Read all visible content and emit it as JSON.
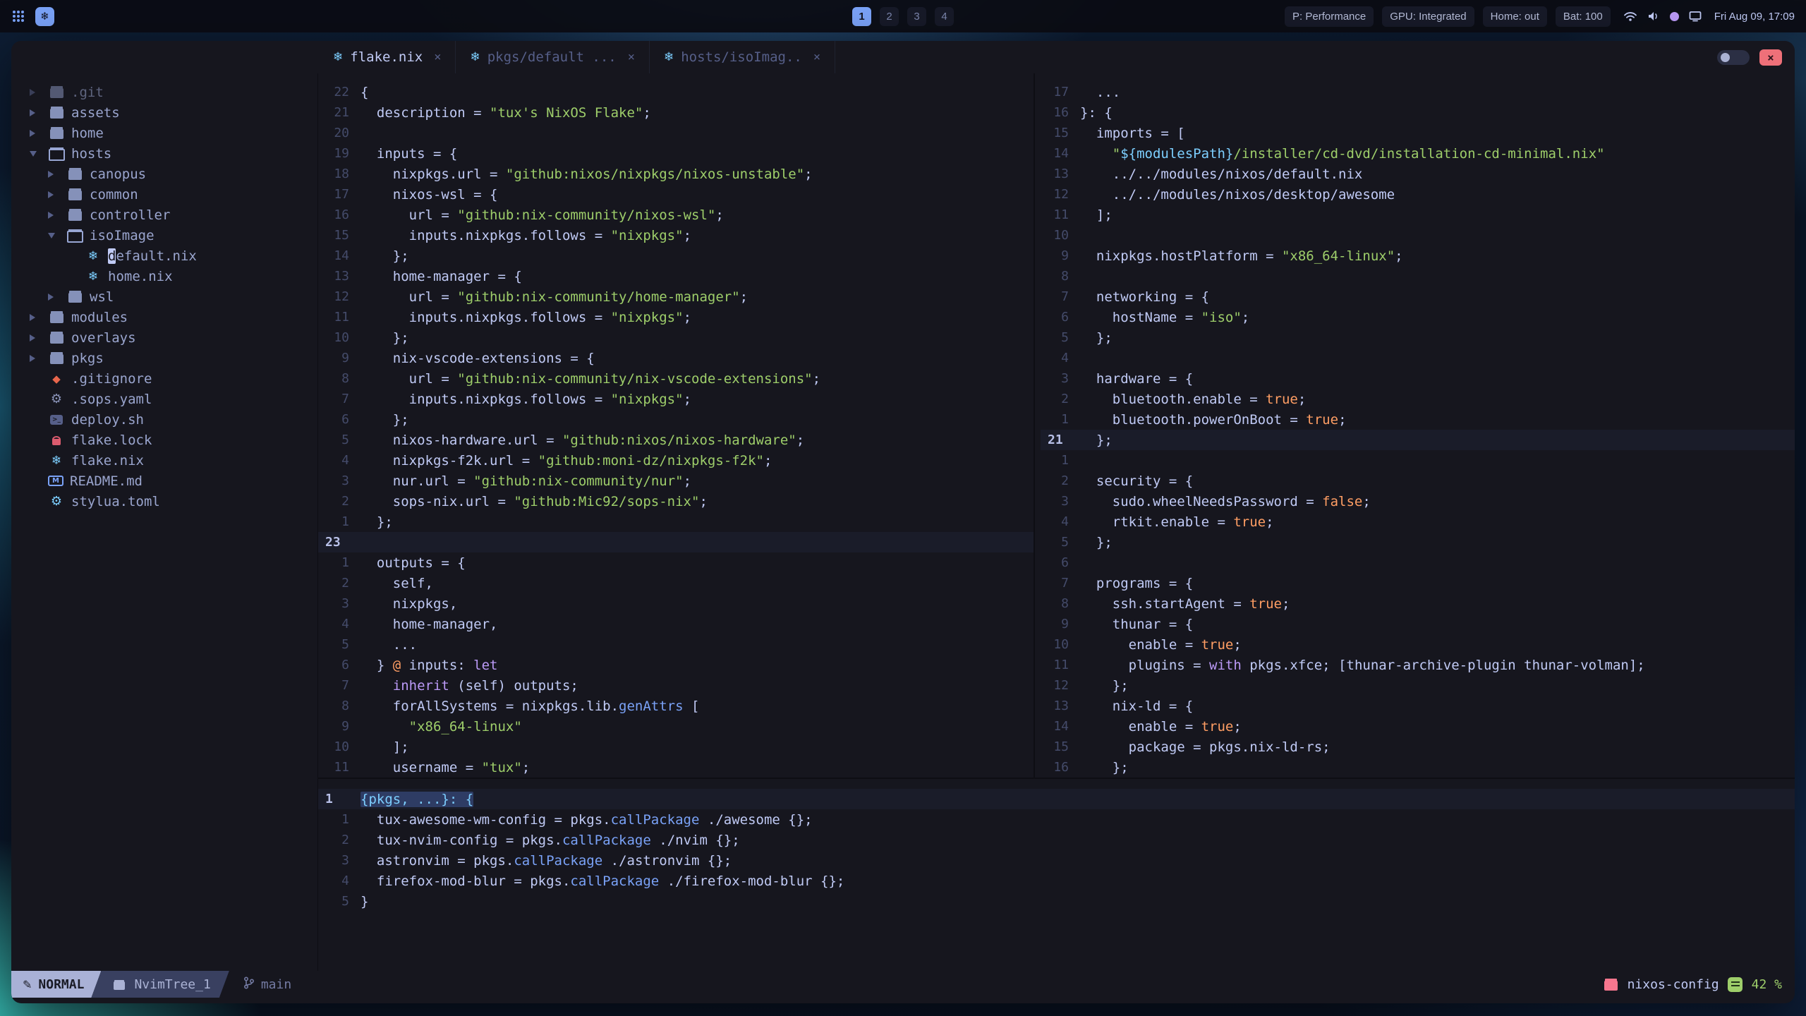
{
  "colors": {
    "accent": "#7aa2f7",
    "bg": "#16161e",
    "string": "#9ece6a",
    "boolean": "#ff9e64",
    "keyword": "#bb9af7",
    "function_": "#7aa2f7",
    "pink": "#f7768e",
    "green": "#9ece6a",
    "cyan": "#7dcfff"
  },
  "icons": {
    "logo_glyph": "❄",
    "close_glyph": "×",
    "pencil_glyph": "✎",
    "nix_glyph": "❄",
    "diamond_glyph": "◆",
    "gear_glyph": "⚙"
  },
  "topbar": {
    "workspaces": [
      {
        "label": "1",
        "active": true
      },
      {
        "label": "2",
        "active": false
      },
      {
        "label": "3",
        "active": false
      },
      {
        "label": "4",
        "active": false
      }
    ],
    "status_items": [
      {
        "name": "power-profile",
        "label": "P: Performance"
      },
      {
        "name": "gpu",
        "label": "GPU: Integrated"
      },
      {
        "name": "home",
        "label": "Home: out"
      },
      {
        "name": "battery",
        "label": "Bat: 100"
      }
    ],
    "tray": [
      "wifi",
      "volume",
      "accent-dot",
      "display"
    ],
    "clock": "Fri Aug 09, 17:09"
  },
  "window": {
    "tabs": [
      {
        "label": "flake.nix",
        "active": true
      },
      {
        "label": "pkgs/default ...",
        "active": false
      },
      {
        "label": "hosts/isoImag..",
        "active": false
      }
    ]
  },
  "tree": {
    "items": [
      {
        "indent": 0,
        "chev": "closed",
        "icon": "folder",
        "label": ".git",
        "dim": true
      },
      {
        "indent": 0,
        "chev": "closed",
        "icon": "folder",
        "label": "assets"
      },
      {
        "indent": 0,
        "chev": "closed",
        "icon": "folder",
        "label": "home"
      },
      {
        "indent": 0,
        "chev": "open",
        "icon": "folder-open",
        "label": "hosts"
      },
      {
        "indent": 1,
        "chev": "closed",
        "icon": "folder",
        "label": "canopus"
      },
      {
        "indent": 1,
        "chev": "closed",
        "icon": "folder",
        "label": "common"
      },
      {
        "indent": 1,
        "chev": "closed",
        "icon": "folder",
        "label": "controller"
      },
      {
        "indent": 1,
        "chev": "open",
        "icon": "folder-open",
        "label": "isoImage"
      },
      {
        "indent": 2,
        "chev": null,
        "icon": "nix",
        "label": "default.nix",
        "cursor": true
      },
      {
        "indent": 2,
        "chev": null,
        "icon": "nix",
        "label": "home.nix"
      },
      {
        "indent": 1,
        "chev": "closed",
        "icon": "folder",
        "label": "wsl"
      },
      {
        "indent": 0,
        "chev": "closed",
        "icon": "folder",
        "label": "modules"
      },
      {
        "indent": 0,
        "chev": "closed",
        "icon": "folder",
        "label": "overlays"
      },
      {
        "indent": 0,
        "chev": "closed",
        "icon": "folder",
        "label": "pkgs"
      },
      {
        "indent": 0,
        "chev": null,
        "icon": "git",
        "label": ".gitignore"
      },
      {
        "indent": 0,
        "chev": null,
        "icon": "gear",
        "label": ".sops.yaml"
      },
      {
        "indent": 0,
        "chev": null,
        "icon": "shell",
        "label": "deploy.sh"
      },
      {
        "indent": 0,
        "chev": null,
        "icon": "lock",
        "label": "flake.lock"
      },
      {
        "indent": 0,
        "chev": null,
        "icon": "nix",
        "label": "flake.nix"
      },
      {
        "indent": 0,
        "chev": null,
        "icon": "markdown",
        "label": "README.md"
      },
      {
        "indent": 0,
        "chev": null,
        "icon": "gear-blue",
        "label": "stylua.toml"
      }
    ]
  },
  "panes": {
    "flake": {
      "lines": [
        {
          "n": "22",
          "seg": [
            [
              "p",
              "{"
            ]
          ]
        },
        {
          "n": "21",
          "seg": [
            [
              "p",
              "  description = "
            ],
            [
              "s",
              "\"tux's NixOS Flake\""
            ],
            [
              "p",
              ";"
            ]
          ]
        },
        {
          "n": "20",
          "seg": []
        },
        {
          "n": "19",
          "seg": [
            [
              "p",
              "  inputs = {"
            ]
          ]
        },
        {
          "n": "18",
          "seg": [
            [
              "p",
              "    nixpkgs.url = "
            ],
            [
              "s",
              "\"github:nixos/nixpkgs/nixos-unstable\""
            ],
            [
              "p",
              ";"
            ]
          ]
        },
        {
          "n": "17",
          "seg": [
            [
              "p",
              "    nixos-wsl = {"
            ]
          ]
        },
        {
          "n": "16",
          "seg": [
            [
              "p",
              "      url = "
            ],
            [
              "s",
              "\"github:nix-community/nixos-wsl\""
            ],
            [
              "p",
              ";"
            ]
          ]
        },
        {
          "n": "15",
          "seg": [
            [
              "p",
              "      inputs.nixpkgs.follows = "
            ],
            [
              "s",
              "\"nixpkgs\""
            ],
            [
              "p",
              ";"
            ]
          ]
        },
        {
          "n": "14",
          "seg": [
            [
              "p",
              "    };"
            ]
          ]
        },
        {
          "n": "13",
          "seg": [
            [
              "p",
              "    home-manager = {"
            ]
          ]
        },
        {
          "n": "12",
          "seg": [
            [
              "p",
              "      url = "
            ],
            [
              "s",
              "\"github:nix-community/home-manager\""
            ],
            [
              "p",
              ";"
            ]
          ]
        },
        {
          "n": "11",
          "seg": [
            [
              "p",
              "      inputs.nixpkgs.follows = "
            ],
            [
              "s",
              "\"nixpkgs\""
            ],
            [
              "p",
              ";"
            ]
          ]
        },
        {
          "n": "10",
          "seg": [
            [
              "p",
              "    };"
            ]
          ]
        },
        {
          "n": "9",
          "seg": [
            [
              "p",
              "    nix-vscode-extensions = {"
            ]
          ]
        },
        {
          "n": "8",
          "seg": [
            [
              "p",
              "      url = "
            ],
            [
              "s",
              "\"github:nix-community/nix-vscode-extensions\""
            ],
            [
              "p",
              ";"
            ]
          ]
        },
        {
          "n": "7",
          "seg": [
            [
              "p",
              "      inputs.nixpkgs.follows = "
            ],
            [
              "s",
              "\"nixpkgs\""
            ],
            [
              "p",
              ";"
            ]
          ]
        },
        {
          "n": "6",
          "seg": [
            [
              "p",
              "    };"
            ]
          ]
        },
        {
          "n": "5",
          "seg": [
            [
              "p",
              "    nixos-hardware.url = "
            ],
            [
              "s",
              "\"github:nixos/nixos-hardware\""
            ],
            [
              "p",
              ";"
            ]
          ]
        },
        {
          "n": "4",
          "seg": [
            [
              "p",
              "    nixpkgs-f2k.url = "
            ],
            [
              "s",
              "\"github:moni-dz/nixpkgs-f2k\""
            ],
            [
              "p",
              ";"
            ]
          ]
        },
        {
          "n": "3",
          "seg": [
            [
              "p",
              "    nur.url = "
            ],
            [
              "s",
              "\"github:nix-community/nur\""
            ],
            [
              "p",
              ";"
            ]
          ]
        },
        {
          "n": "2",
          "seg": [
            [
              "p",
              "    sops-nix.url = "
            ],
            [
              "s",
              "\"github:Mic92/sops-nix\""
            ],
            [
              "p",
              ";"
            ]
          ]
        },
        {
          "n": "1",
          "seg": [
            [
              "p",
              "  };"
            ]
          ]
        },
        {
          "n": "23",
          "cur": true,
          "seg": []
        },
        {
          "n": "1",
          "seg": [
            [
              "p",
              "  outputs = {"
            ]
          ]
        },
        {
          "n": "2",
          "seg": [
            [
              "p",
              "    self,"
            ]
          ]
        },
        {
          "n": "3",
          "seg": [
            [
              "p",
              "    nixpkgs,"
            ]
          ]
        },
        {
          "n": "4",
          "seg": [
            [
              "p",
              "    home-manager,"
            ]
          ]
        },
        {
          "n": "5",
          "seg": [
            [
              "p",
              "    ..."
            ]
          ]
        },
        {
          "n": "6",
          "seg": [
            [
              "p",
              "  } "
            ],
            [
              "b",
              "@"
            ],
            [
              "p",
              " inputs: "
            ],
            [
              "k",
              "let"
            ]
          ]
        },
        {
          "n": "7",
          "seg": [
            [
              "p",
              "    "
            ],
            [
              "k",
              "inherit"
            ],
            [
              "p",
              " (self) outputs;"
            ]
          ]
        },
        {
          "n": "8",
          "seg": [
            [
              "p",
              "    forAllSystems = nixpkgs.lib."
            ],
            [
              "f",
              "genAttrs"
            ],
            [
              "p",
              " ["
            ]
          ]
        },
        {
          "n": "9",
          "seg": [
            [
              "p",
              "      "
            ],
            [
              "s",
              "\"x86_64-linux\""
            ]
          ]
        },
        {
          "n": "10",
          "seg": [
            [
              "p",
              "    ];"
            ]
          ]
        },
        {
          "n": "11",
          "seg": [
            [
              "p",
              "    username = "
            ],
            [
              "s",
              "\"tux\""
            ],
            [
              "p",
              ";"
            ]
          ]
        }
      ]
    },
    "iso": {
      "lines": [
        {
          "n": "17",
          "seg": [
            [
              "p",
              "  ..."
            ]
          ]
        },
        {
          "n": "16",
          "seg": [
            [
              "p",
              "}: {"
            ]
          ]
        },
        {
          "n": "15",
          "seg": [
            [
              "p",
              "  imports = ["
            ]
          ]
        },
        {
          "n": "14",
          "seg": [
            [
              "p",
              "    "
            ],
            [
              "s",
              "\""
            ],
            [
              "i",
              "${modulesPath}"
            ],
            [
              "s",
              "/installer/cd-dvd/installation-cd-minimal.nix\""
            ]
          ]
        },
        {
          "n": "13",
          "seg": [
            [
              "p",
              "    ../../modules/nixos/default.nix"
            ]
          ]
        },
        {
          "n": "12",
          "seg": [
            [
              "p",
              "    ../../modules/nixos/desktop/awesome"
            ]
          ]
        },
        {
          "n": "11",
          "seg": [
            [
              "p",
              "  ];"
            ]
          ]
        },
        {
          "n": "10",
          "seg": []
        },
        {
          "n": "9",
          "seg": [
            [
              "p",
              "  nixpkgs.hostPlatform = "
            ],
            [
              "s",
              "\"x86_64-linux\""
            ],
            [
              "p",
              ";"
            ]
          ]
        },
        {
          "n": "8",
          "seg": []
        },
        {
          "n": "7",
          "seg": [
            [
              "p",
              "  networking = {"
            ]
          ]
        },
        {
          "n": "6",
          "seg": [
            [
              "p",
              "    hostName = "
            ],
            [
              "s",
              "\"iso\""
            ],
            [
              "p",
              ";"
            ]
          ]
        },
        {
          "n": "5",
          "seg": [
            [
              "p",
              "  };"
            ]
          ]
        },
        {
          "n": "4",
          "seg": []
        },
        {
          "n": "3",
          "seg": [
            [
              "p",
              "  hardware = {"
            ]
          ]
        },
        {
          "n": "2",
          "seg": [
            [
              "p",
              "    bluetooth.enable = "
            ],
            [
              "b",
              "true"
            ],
            [
              "p",
              ";"
            ]
          ]
        },
        {
          "n": "1",
          "seg": [
            [
              "p",
              "    bluetooth.powerOnBoot = "
            ],
            [
              "b",
              "true"
            ],
            [
              "p",
              ";"
            ]
          ]
        },
        {
          "n": "21",
          "cur": true,
          "seg": [
            [
              "p",
              "  };"
            ]
          ]
        },
        {
          "n": "1",
          "seg": []
        },
        {
          "n": "2",
          "seg": [
            [
              "p",
              "  security = {"
            ]
          ]
        },
        {
          "n": "3",
          "seg": [
            [
              "p",
              "    sudo.wheelNeedsPassword = "
            ],
            [
              "b",
              "false"
            ],
            [
              "p",
              ";"
            ]
          ]
        },
        {
          "n": "4",
          "seg": [
            [
              "p",
              "    rtkit.enable = "
            ],
            [
              "b",
              "true"
            ],
            [
              "p",
              ";"
            ]
          ]
        },
        {
          "n": "5",
          "seg": [
            [
              "p",
              "  };"
            ]
          ]
        },
        {
          "n": "6",
          "seg": []
        },
        {
          "n": "7",
          "seg": [
            [
              "p",
              "  programs = {"
            ]
          ]
        },
        {
          "n": "8",
          "seg": [
            [
              "p",
              "    ssh.startAgent = "
            ],
            [
              "b",
              "true"
            ],
            [
              "p",
              ";"
            ]
          ]
        },
        {
          "n": "9",
          "seg": [
            [
              "p",
              "    thunar = {"
            ]
          ]
        },
        {
          "n": "10",
          "seg": [
            [
              "p",
              "      enable = "
            ],
            [
              "b",
              "true"
            ],
            [
              "p",
              ";"
            ]
          ]
        },
        {
          "n": "11",
          "seg": [
            [
              "p",
              "      plugins = "
            ],
            [
              "k",
              "with"
            ],
            [
              "p",
              " pkgs.xfce; [thunar-archive-plugin thunar-volman];"
            ]
          ]
        },
        {
          "n": "12",
          "seg": [
            [
              "p",
              "    };"
            ]
          ]
        },
        {
          "n": "13",
          "seg": [
            [
              "p",
              "    nix-ld = {"
            ]
          ]
        },
        {
          "n": "14",
          "seg": [
            [
              "p",
              "      enable = "
            ],
            [
              "b",
              "true"
            ],
            [
              "p",
              ";"
            ]
          ]
        },
        {
          "n": "15",
          "seg": [
            [
              "p",
              "      package = pkgs.nix-ld-rs;"
            ]
          ]
        },
        {
          "n": "16",
          "seg": [
            [
              "p",
              "    };"
            ]
          ]
        }
      ]
    },
    "pkgs": {
      "lines": [
        {
          "n": "1",
          "cur": true,
          "seg": [
            [
              "v",
              "{pkgs, ...}: {"
            ]
          ]
        },
        {
          "n": "1",
          "seg": [
            [
              "p",
              "  tux-awesome-wm-config = pkgs."
            ],
            [
              "f",
              "callPackage"
            ],
            [
              "p",
              " ./awesome {};"
            ]
          ]
        },
        {
          "n": "2",
          "seg": [
            [
              "p",
              "  tux-nvim-config = pkgs."
            ],
            [
              "f",
              "callPackage"
            ],
            [
              "p",
              " ./nvim {};"
            ]
          ]
        },
        {
          "n": "3",
          "seg": [
            [
              "p",
              "  astronvim = pkgs."
            ],
            [
              "f",
              "callPackage"
            ],
            [
              "p",
              " ./astronvim {};"
            ]
          ]
        },
        {
          "n": "4",
          "seg": [
            [
              "p",
              "  firefox-mod-blur = pkgs."
            ],
            [
              "f",
              "callPackage"
            ],
            [
              "p",
              " ./firefox-mod-blur {};"
            ]
          ]
        },
        {
          "n": "5",
          "seg": [
            [
              "p",
              "}"
            ]
          ]
        }
      ]
    }
  },
  "statusline": {
    "mode": "NORMAL",
    "buffer": "NvimTree_1",
    "branch": "main",
    "project": "nixos-config",
    "scroll": "42 %"
  }
}
